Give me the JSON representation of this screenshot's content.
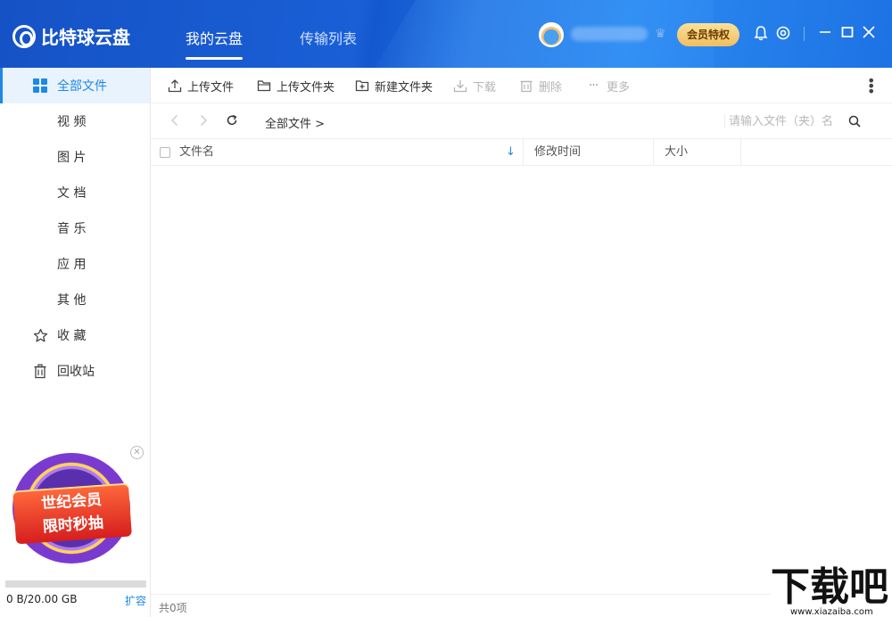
{
  "header": {
    "app_name": "比特球云盘",
    "tabs": [
      {
        "label": "我的云盘",
        "active": true
      },
      {
        "label": "传输列表",
        "active": false
      }
    ],
    "vip_button": "会员特权",
    "accent": "#1e88e5"
  },
  "sidebar": {
    "items": [
      {
        "label": "全部文件",
        "icon": "grid-icon",
        "active": true
      },
      {
        "label": "视 频"
      },
      {
        "label": "图 片"
      },
      {
        "label": "文 档"
      },
      {
        "label": "音 乐"
      },
      {
        "label": "应 用"
      },
      {
        "label": "其 他"
      },
      {
        "label": "收 藏",
        "icon": "star-icon"
      },
      {
        "label": "回收站",
        "icon": "trash-icon"
      }
    ],
    "promo": {
      "line1": "世纪会员",
      "line2": "限时秒抽"
    },
    "storage": {
      "text": "0 B/20.00 GB",
      "used_fraction": 0,
      "expand_label": "扩容"
    }
  },
  "toolbar": {
    "upload_file": "上传文件",
    "upload_folder": "上传文件夹",
    "new_folder": "新建文件夹",
    "download": "下载",
    "delete": "删除",
    "more": "更多"
  },
  "pathbar": {
    "breadcrumb": "全部文件 >",
    "search_placeholder": "请输入文件（夹）名"
  },
  "table": {
    "columns": [
      "文件名",
      "修改时间",
      "大小"
    ],
    "rows": []
  },
  "status": {
    "count_text": "共0项"
  },
  "watermark": {
    "big": "下载吧",
    "small": "www.xiazaiba.com"
  }
}
